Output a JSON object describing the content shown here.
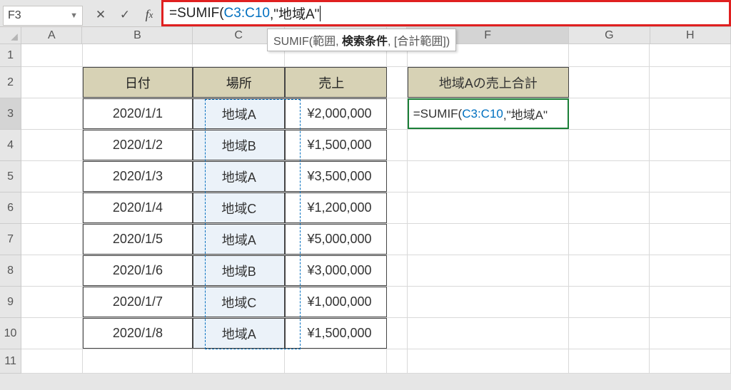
{
  "namebox": {
    "value": "F3"
  },
  "formula": {
    "prefix": "=SUMIF(",
    "ref": "C3:C10",
    "suffix": ",\"地域A\""
  },
  "tooltip": {
    "func": "SUMIF",
    "arg1": "範囲",
    "arg2": "検索条件",
    "arg3": "[合計範囲]"
  },
  "columns": [
    "A",
    "B",
    "C",
    "D",
    "E",
    "F",
    "G",
    "H"
  ],
  "rows": [
    "1",
    "2",
    "3",
    "4",
    "5",
    "6",
    "7",
    "8",
    "9",
    "10",
    "11"
  ],
  "table": {
    "headers": {
      "date": "日付",
      "place": "場所",
      "sales": "売上"
    },
    "data": [
      {
        "date": "2020/1/1",
        "place": "地域A",
        "sales": "¥2,000,000"
      },
      {
        "date": "2020/1/2",
        "place": "地域B",
        "sales": "¥1,500,000"
      },
      {
        "date": "2020/1/3",
        "place": "地域A",
        "sales": "¥3,500,000"
      },
      {
        "date": "2020/1/4",
        "place": "地域C",
        "sales": "¥1,200,000"
      },
      {
        "date": "2020/1/5",
        "place": "地域A",
        "sales": "¥5,000,000"
      },
      {
        "date": "2020/1/6",
        "place": "地域B",
        "sales": "¥3,000,000"
      },
      {
        "date": "2020/1/7",
        "place": "地域C",
        "sales": "¥1,000,000"
      },
      {
        "date": "2020/1/8",
        "place": "地域A",
        "sales": "¥1,500,000"
      }
    ]
  },
  "side": {
    "header": "地域Aの売上合計",
    "editing": {
      "prefix": "=SUMIF(",
      "ref": "C3:C10",
      "suffix": ",\"地域A\""
    }
  }
}
